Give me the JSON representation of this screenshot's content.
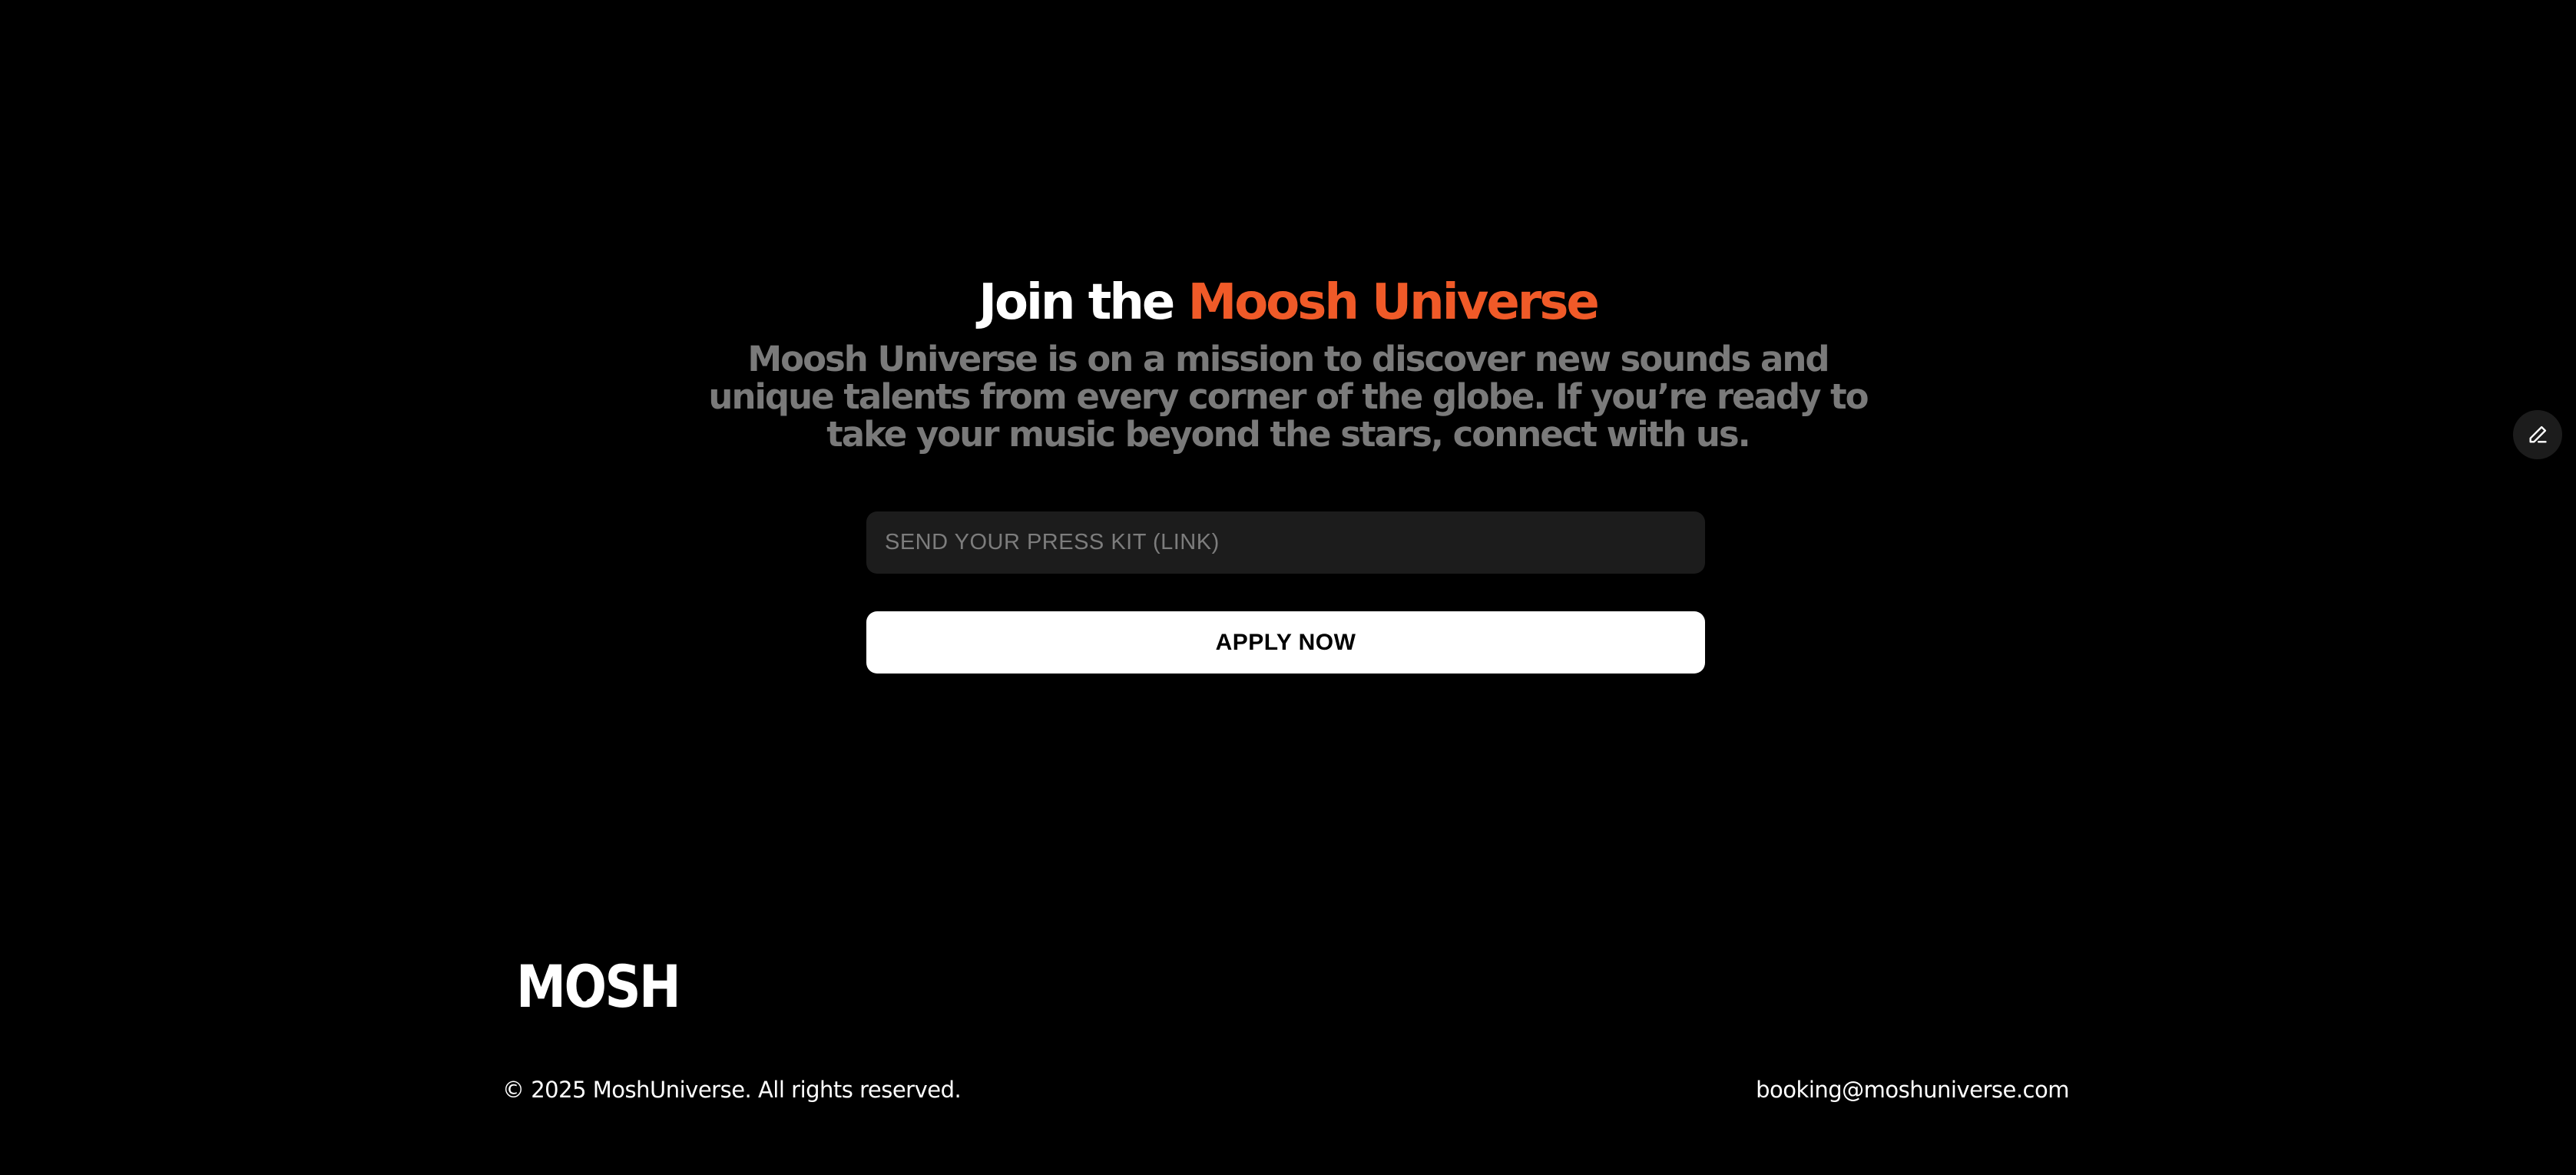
{
  "hero": {
    "title_prefix": "Join the",
    "title_accent": "Moosh Universe",
    "subtitle": "Moosh Universe is on a mission to discover new sounds and unique talents from every corner of the globe. If you’re ready to take your music beyond the stars, connect with us."
  },
  "form": {
    "press_kit_placeholder": "SEND YOUR PRESS KIT (LINK)",
    "press_kit_value": "",
    "apply_label": "APPLY NOW"
  },
  "footer": {
    "logo_text_before": "M",
    "logo_text_o": "O",
    "logo_text_after": "SH",
    "copyright": "© 2025 MoshUniverse. All rights reserved.",
    "email": "booking@moshuniverse.com"
  },
  "floating_action": {
    "icon": "pencil-icon"
  },
  "colors": {
    "background": "#000000",
    "accent": "#f05a28",
    "subtitle": "#7a7a7a",
    "input_bg": "#1c1c1c",
    "button_bg": "#ffffff"
  }
}
